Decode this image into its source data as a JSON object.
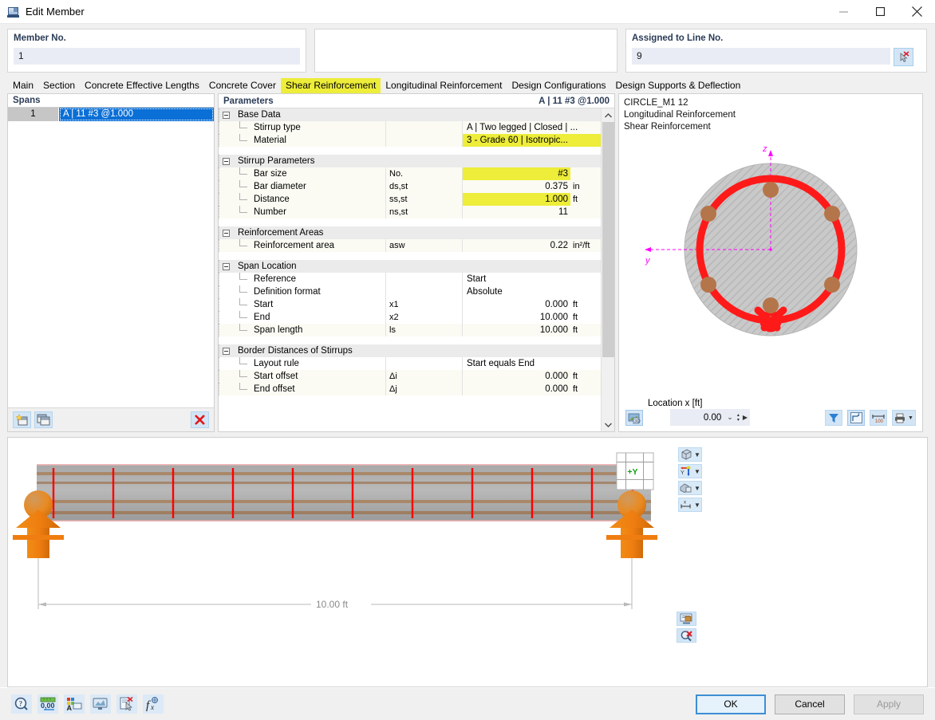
{
  "window": {
    "title": "Edit Member",
    "minimize": "–",
    "maximize": "□",
    "close": "✕"
  },
  "header": {
    "member_label": "Member No.",
    "member_value": "1",
    "assigned_label": "Assigned to Line No.",
    "assigned_value": "9"
  },
  "tabs": [
    {
      "label": "Main",
      "active": false
    },
    {
      "label": "Section",
      "active": false
    },
    {
      "label": "Concrete Effective Lengths",
      "active": false
    },
    {
      "label": "Concrete Cover",
      "active": false
    },
    {
      "label": "Shear Reinforcement",
      "active": true
    },
    {
      "label": "Longitudinal Reinforcement",
      "active": false
    },
    {
      "label": "Design Configurations",
      "active": false
    },
    {
      "label": "Design Supports & Deflection",
      "active": false
    }
  ],
  "spans": {
    "title": "Spans",
    "col_no": "",
    "col_desc": "",
    "rows": [
      {
        "no": "1",
        "desc": "A | 11 #3 @1.000"
      }
    ]
  },
  "parameters": {
    "title": "Parameters",
    "subtitle": "A | 11 #3 @1.000",
    "groups": [
      {
        "name": "Base Data",
        "rows": [
          {
            "name": "Stirrup type",
            "symbol": "",
            "value": "A | Two legged | Closed | ...",
            "unit": "",
            "highlight": false,
            "align": "left"
          },
          {
            "name": "Material",
            "symbol": "",
            "value": "3 - Grade 60 | Isotropic...",
            "unit": "",
            "highlight": true,
            "align": "left",
            "swatch": "#8c4a16"
          }
        ]
      },
      {
        "name": "Stirrup Parameters",
        "rows": [
          {
            "name": "Bar size",
            "symbol": "No.",
            "value": "#3",
            "unit": "",
            "highlight": true,
            "align": "right"
          },
          {
            "name": "Bar diameter",
            "symbol": "ds,st",
            "value": "0.375",
            "unit": "in",
            "highlight": false,
            "align": "right"
          },
          {
            "name": "Distance",
            "symbol": "ss,st",
            "value": "1.000",
            "unit": "ft",
            "highlight": true,
            "align": "right"
          },
          {
            "name": "Number",
            "symbol": "ns,st",
            "value": "11",
            "unit": "",
            "highlight": false,
            "align": "right"
          }
        ]
      },
      {
        "name": "Reinforcement Areas",
        "rows": [
          {
            "name": "Reinforcement area",
            "symbol": "asw",
            "value": "0.22",
            "unit": "in²/ft",
            "highlight": false,
            "align": "right"
          }
        ]
      },
      {
        "name": "Span Location",
        "rows": [
          {
            "name": "Reference",
            "symbol": "",
            "value": "Start",
            "unit": "",
            "highlight": false,
            "align": "left"
          },
          {
            "name": "Definition format",
            "symbol": "",
            "value": "Absolute",
            "unit": "",
            "highlight": false,
            "align": "left"
          },
          {
            "name": "Start",
            "symbol": "x1",
            "value": "0.000",
            "unit": "ft",
            "highlight": false,
            "align": "right"
          },
          {
            "name": "End",
            "symbol": "x2",
            "value": "10.000",
            "unit": "ft",
            "highlight": false,
            "align": "right"
          },
          {
            "name": "Span length",
            "symbol": "ls",
            "value": "10.000",
            "unit": "ft",
            "highlight": false,
            "align": "right"
          }
        ]
      },
      {
        "name": "Border Distances of Stirrups",
        "rows": [
          {
            "name": "Layout rule",
            "symbol": "",
            "value": "Start equals End",
            "unit": "",
            "highlight": false,
            "align": "left"
          },
          {
            "name": "Start offset",
            "symbol": "Δi",
            "value": "0.000",
            "unit": "ft",
            "highlight": false,
            "align": "right"
          },
          {
            "name": "End offset",
            "symbol": "Δj",
            "value": "0.000",
            "unit": "ft",
            "highlight": false,
            "align": "right"
          }
        ]
      }
    ]
  },
  "section_view": {
    "line1": "CIRCLE_M1 12",
    "line2": "Longitudinal Reinforcement",
    "line3": "Shear Reinforcement",
    "axis_z": "z",
    "axis_y": "y",
    "location_label": "Location x [ft]",
    "location_value": "0.00",
    "stirrup_color": "#ff1a1a",
    "bar_color": "#b5754a",
    "concrete_color": "#c8c8c8"
  },
  "model_view": {
    "dimension_label": "10.00 ft",
    "axis_label": "+Y",
    "stirrup_color": "#ff0000",
    "support_color": "#ef7d10"
  },
  "footer": {
    "ok": "OK",
    "cancel": "Cancel",
    "apply": "Apply"
  },
  "icons": {
    "app": "edit-member-icon",
    "pick": "pick-line-cursor-icon",
    "new_span": "new-span-icon",
    "copy_span": "copy-span-icon",
    "delete_span": "delete-span-icon",
    "render": "render-mode-icon",
    "filter": "filter-icon",
    "coords": "coordinate-system-icon",
    "dims": "dimensions-icon",
    "print": "print-icon",
    "help": "help-icon",
    "units": "units-icon",
    "display_props": "display-properties-icon",
    "visual": "visualization-icon",
    "select": "select-object-icon",
    "formula": "formula-icon"
  }
}
